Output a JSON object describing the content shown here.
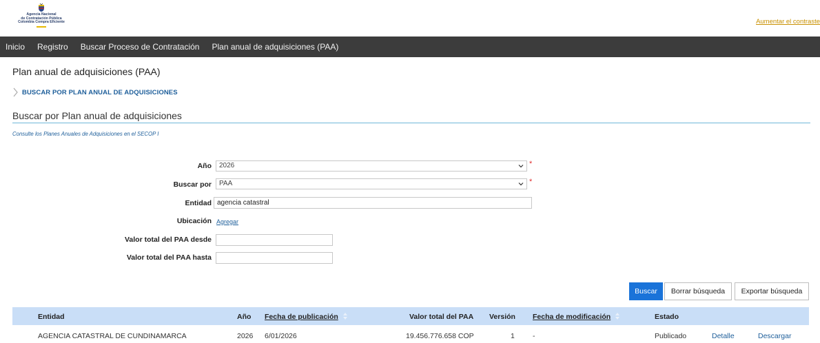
{
  "header": {
    "logo_lines": [
      "Agencia Nacional",
      "de Contratación Pública",
      "Colombia Compra Eficiente"
    ],
    "contrast_link": "Aumentar el contraste"
  },
  "nav": {
    "items": [
      "Inicio",
      "Registro",
      "Buscar Proceso de Contratación",
      "Plan anual de adquisiciones (PAA)"
    ]
  },
  "page": {
    "title": "Plan anual de adquisiciones (PAA)",
    "breadcrumb": "BUSCAR POR PLAN ANUAL DE ADQUISICIONES",
    "section_title": "Buscar por Plan anual de adquisiciones",
    "consult_text": "Consulte los Planes Anuales de Adquisiciones en el SECOP I"
  },
  "form": {
    "anio_label": "Año",
    "anio_value": "2026",
    "buscar_por_label": "Buscar por",
    "buscar_por_value": "PAA",
    "entidad_label": "Entidad",
    "entidad_value": "agencia catastral",
    "ubicacion_label": "Ubicación",
    "ubicacion_link": "Agregar",
    "desde_label": "Valor total del PAA desde",
    "desde_value": "",
    "hasta_label": "Valor total del PAA hasta",
    "hasta_value": "",
    "required_mark": "*"
  },
  "buttons": {
    "buscar": "Buscar",
    "borrar": "Borrar búsqueda",
    "exportar": "Exportar búsqueda"
  },
  "table": {
    "headers": {
      "entidad": "Entidad",
      "anio": "Año",
      "fecha_publicacion": "Fecha de publicación",
      "valor_total": "Valor total del PAA",
      "version": "Versión",
      "fecha_modificacion": "Fecha de modificación",
      "estado": "Estado"
    },
    "rows": [
      {
        "entidad": "AGENCIA CATASTRAL DE CUNDINAMARCA",
        "anio": "2026",
        "fecha_publicacion": "6/01/2026",
        "valor_total": "19.456.776.658 COP",
        "version": "1",
        "fecha_modificacion": "-",
        "estado": "Publicado",
        "detalle": "Detalle",
        "descargar": "Descargar"
      }
    ]
  },
  "colors": {
    "nav_bg": "#3c3c3c",
    "link_blue": "#1d5e9a",
    "primary_button": "#1a73d9",
    "table_header_bg": "#c9def7",
    "required": "#e03030"
  }
}
